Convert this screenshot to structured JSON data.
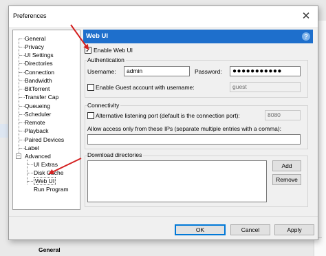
{
  "window": {
    "title": "Preferences",
    "close_glyph": "✕"
  },
  "background": {
    "bottom_label": "General"
  },
  "tree": {
    "items": [
      {
        "label": "General"
      },
      {
        "label": "Privacy"
      },
      {
        "label": "UI Settings"
      },
      {
        "label": "Directories"
      },
      {
        "label": "Connection"
      },
      {
        "label": "Bandwidth"
      },
      {
        "label": "BitTorrent"
      },
      {
        "label": "Transfer Cap"
      },
      {
        "label": "Queueing"
      },
      {
        "label": "Scheduler"
      },
      {
        "label": "Remote"
      },
      {
        "label": "Playback"
      },
      {
        "label": "Paired Devices"
      },
      {
        "label": "Label"
      },
      {
        "label": "Advanced"
      },
      {
        "label": "UI Extras"
      },
      {
        "label": "Disk Cache"
      },
      {
        "label": "Web UI"
      },
      {
        "label": "Run Program"
      }
    ],
    "expander_glyph": "−"
  },
  "webui": {
    "header": "Web UI",
    "help_glyph": "?",
    "enable_label": "Enable Web UI",
    "enable_checked": true,
    "check_glyph": "✓",
    "auth": {
      "title": "Authentication",
      "username_label": "Username:",
      "username_value": "admin",
      "password_label": "Password:",
      "password_value": "●●●●●●●●●●●",
      "guest_label": "Enable Guest account with username:",
      "guest_value": "guest",
      "guest_checked": false
    },
    "connectivity": {
      "title": "Connectivity",
      "alt_port_label": "Alternative listening port (default is the connection port):",
      "alt_port_value": "8080",
      "alt_port_checked": false,
      "allow_ips_label": "Allow access only from these IPs (separate multiple entries with a comma):",
      "allow_ips_value": ""
    },
    "download_dirs": {
      "title": "Download directories",
      "add_label": "Add",
      "remove_label": "Remove"
    }
  },
  "footer": {
    "ok_label": "OK",
    "cancel_label": "Cancel",
    "apply_label": "Apply"
  },
  "annotation": {
    "arrow_color": "#d42020"
  }
}
